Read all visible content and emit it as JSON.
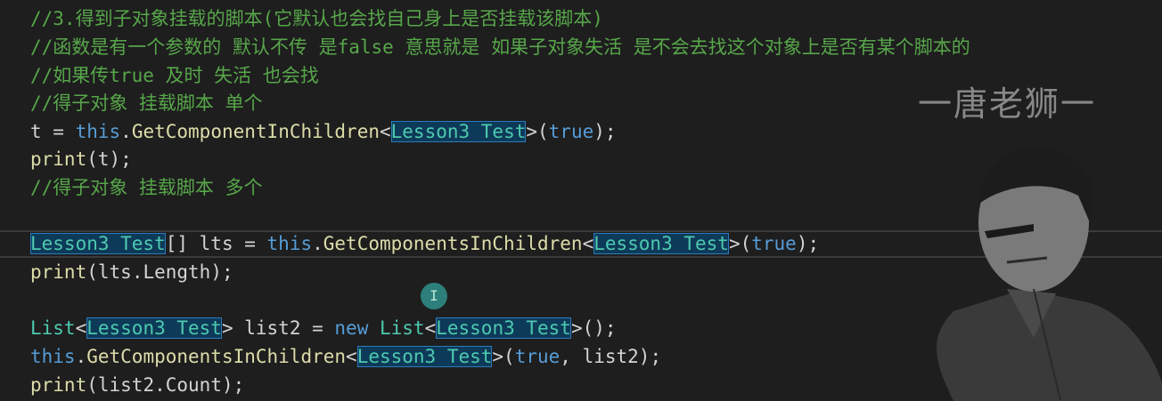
{
  "watermark": "一唐老狮一",
  "mascot_icon": "cartoon-man-portrait-icon",
  "cursor_icon": "text-cursor-icon",
  "cursor_glyph": "I",
  "code": {
    "comment_1": "//3.得到子对象挂载的脚本(它默认也会找自己身上是否挂载该脚本)",
    "comment_2": "//函数是有一个参数的 默认不传 是false 意思就是 如果子对象失活 是不会去找这个对象上是否有某个脚本的",
    "comment_3": "//如果传true 及时 失活 也会找",
    "comment_4": "//得子对象 挂载脚本 单个",
    "comment_5": "//得子对象 挂载脚本 多个",
    "type_name": "Lesson3_Test",
    "kw_this": "this",
    "kw_true": "true",
    "kw_new": "new",
    "fn_get_in_children": "GetComponentInChildren",
    "fn_get_all_in_children": "GetComponentsInChildren",
    "fn_print": "print",
    "var_t": "t",
    "var_lts": "lts",
    "var_list2": "list2",
    "generic_list": "List",
    "prop_length": "Length",
    "prop_count": "Count"
  }
}
